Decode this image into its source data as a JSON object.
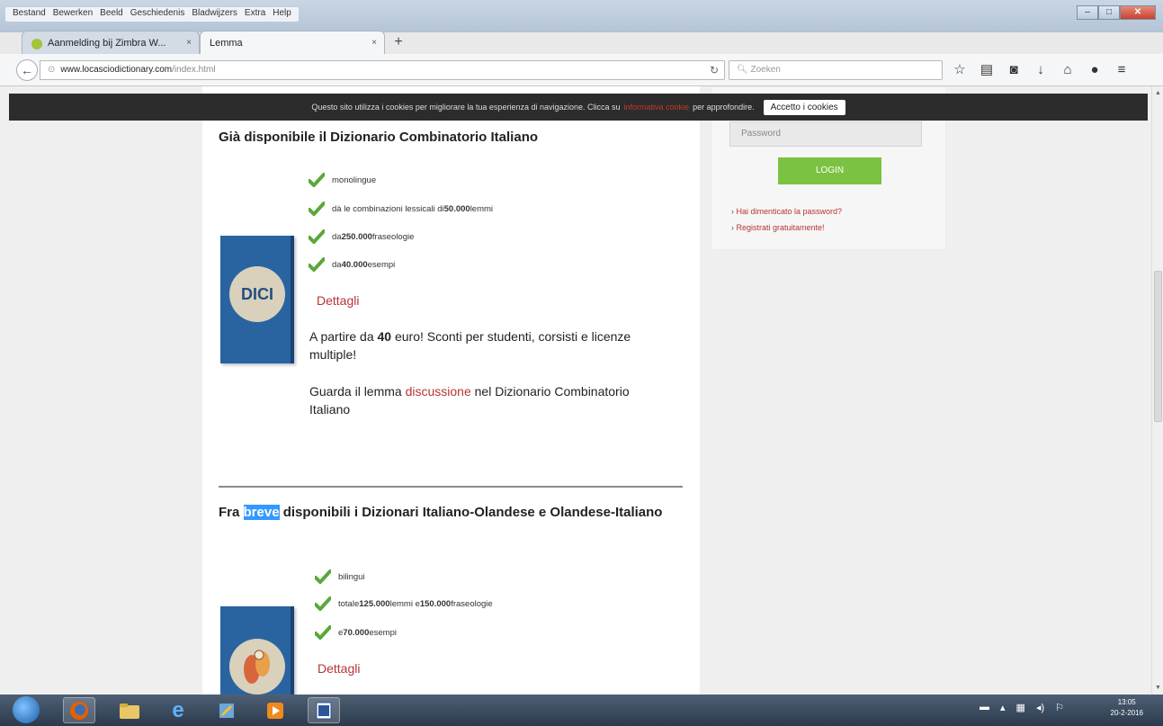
{
  "menu": [
    "Bestand",
    "Bewerken",
    "Beeld",
    "Geschiedenis",
    "Bladwijzers",
    "Extra",
    "Help"
  ],
  "tabs": [
    {
      "label": "Aanmelding bij Zimbra W...",
      "close": "×"
    },
    {
      "label": "Lemma",
      "close": "×"
    }
  ],
  "newtab": "+",
  "url": {
    "host": "www.locasciodictionary.com",
    "path": "/index.html"
  },
  "search": {
    "placeholder": "Zoeken"
  },
  "cookie": {
    "text": "Questo sito utilizza i cookies per migliorare la tua esperienza di navigazione. Clicca su",
    "link": "informativa cookie",
    "after": "per approfondire.",
    "button": "Accetto i cookies"
  },
  "section1": {
    "title": "Già disponibile il Dizionario Combinatorio Italiano",
    "book_label": "DICI",
    "features": [
      {
        "pre": "monolingue",
        "bold": "",
        "post": ""
      },
      {
        "pre": "dà le combinazioni lessicali di ",
        "bold": "50.000",
        "post": " lemmi"
      },
      {
        "pre": "da ",
        "bold": "250.000",
        "post": " fraseologie"
      },
      {
        "pre": "da ",
        "bold": "40.000",
        "post": " esempi"
      }
    ],
    "details": "Dettagli",
    "price_pre": "A partire da ",
    "price_bold": "40",
    "price_post": " euro! Sconti per studenti, corsisti e licenze multiple!",
    "lemma_pre": "Guarda il lemma ",
    "lemma_link": "discussione",
    "lemma_post": " nel Dizionario Combinatorio Italiano"
  },
  "section2": {
    "title_pre": "Fra ",
    "title_hl": "breve",
    "title_post": " disponibili i Dizionari Italiano-Olandese e Olandese-Italiano",
    "features": [
      {
        "pre": "bilingui",
        "bold": "",
        "mid": "",
        "bold2": "",
        "post": ""
      },
      {
        "pre": "totale ",
        "bold": "125.000",
        "mid": " lemmi e ",
        "bold2": "150.000",
        "post": " fraseologie"
      },
      {
        "pre": "e ",
        "bold": "70.000",
        "mid": " esempi",
        "bold2": "",
        "post": ""
      }
    ],
    "details": "Dettagli"
  },
  "login": {
    "password_placeholder": "Password",
    "button": "LOGIN",
    "forgot": "› Hai dimenticato la password?",
    "register": "› Registrati gratuitamente!"
  },
  "clock": {
    "time": "13:05",
    "date": "20-2-2016"
  },
  "colors": {
    "accent_red": "#b73434",
    "login_green": "#7cc242",
    "book_blue": "#2a64a0"
  }
}
